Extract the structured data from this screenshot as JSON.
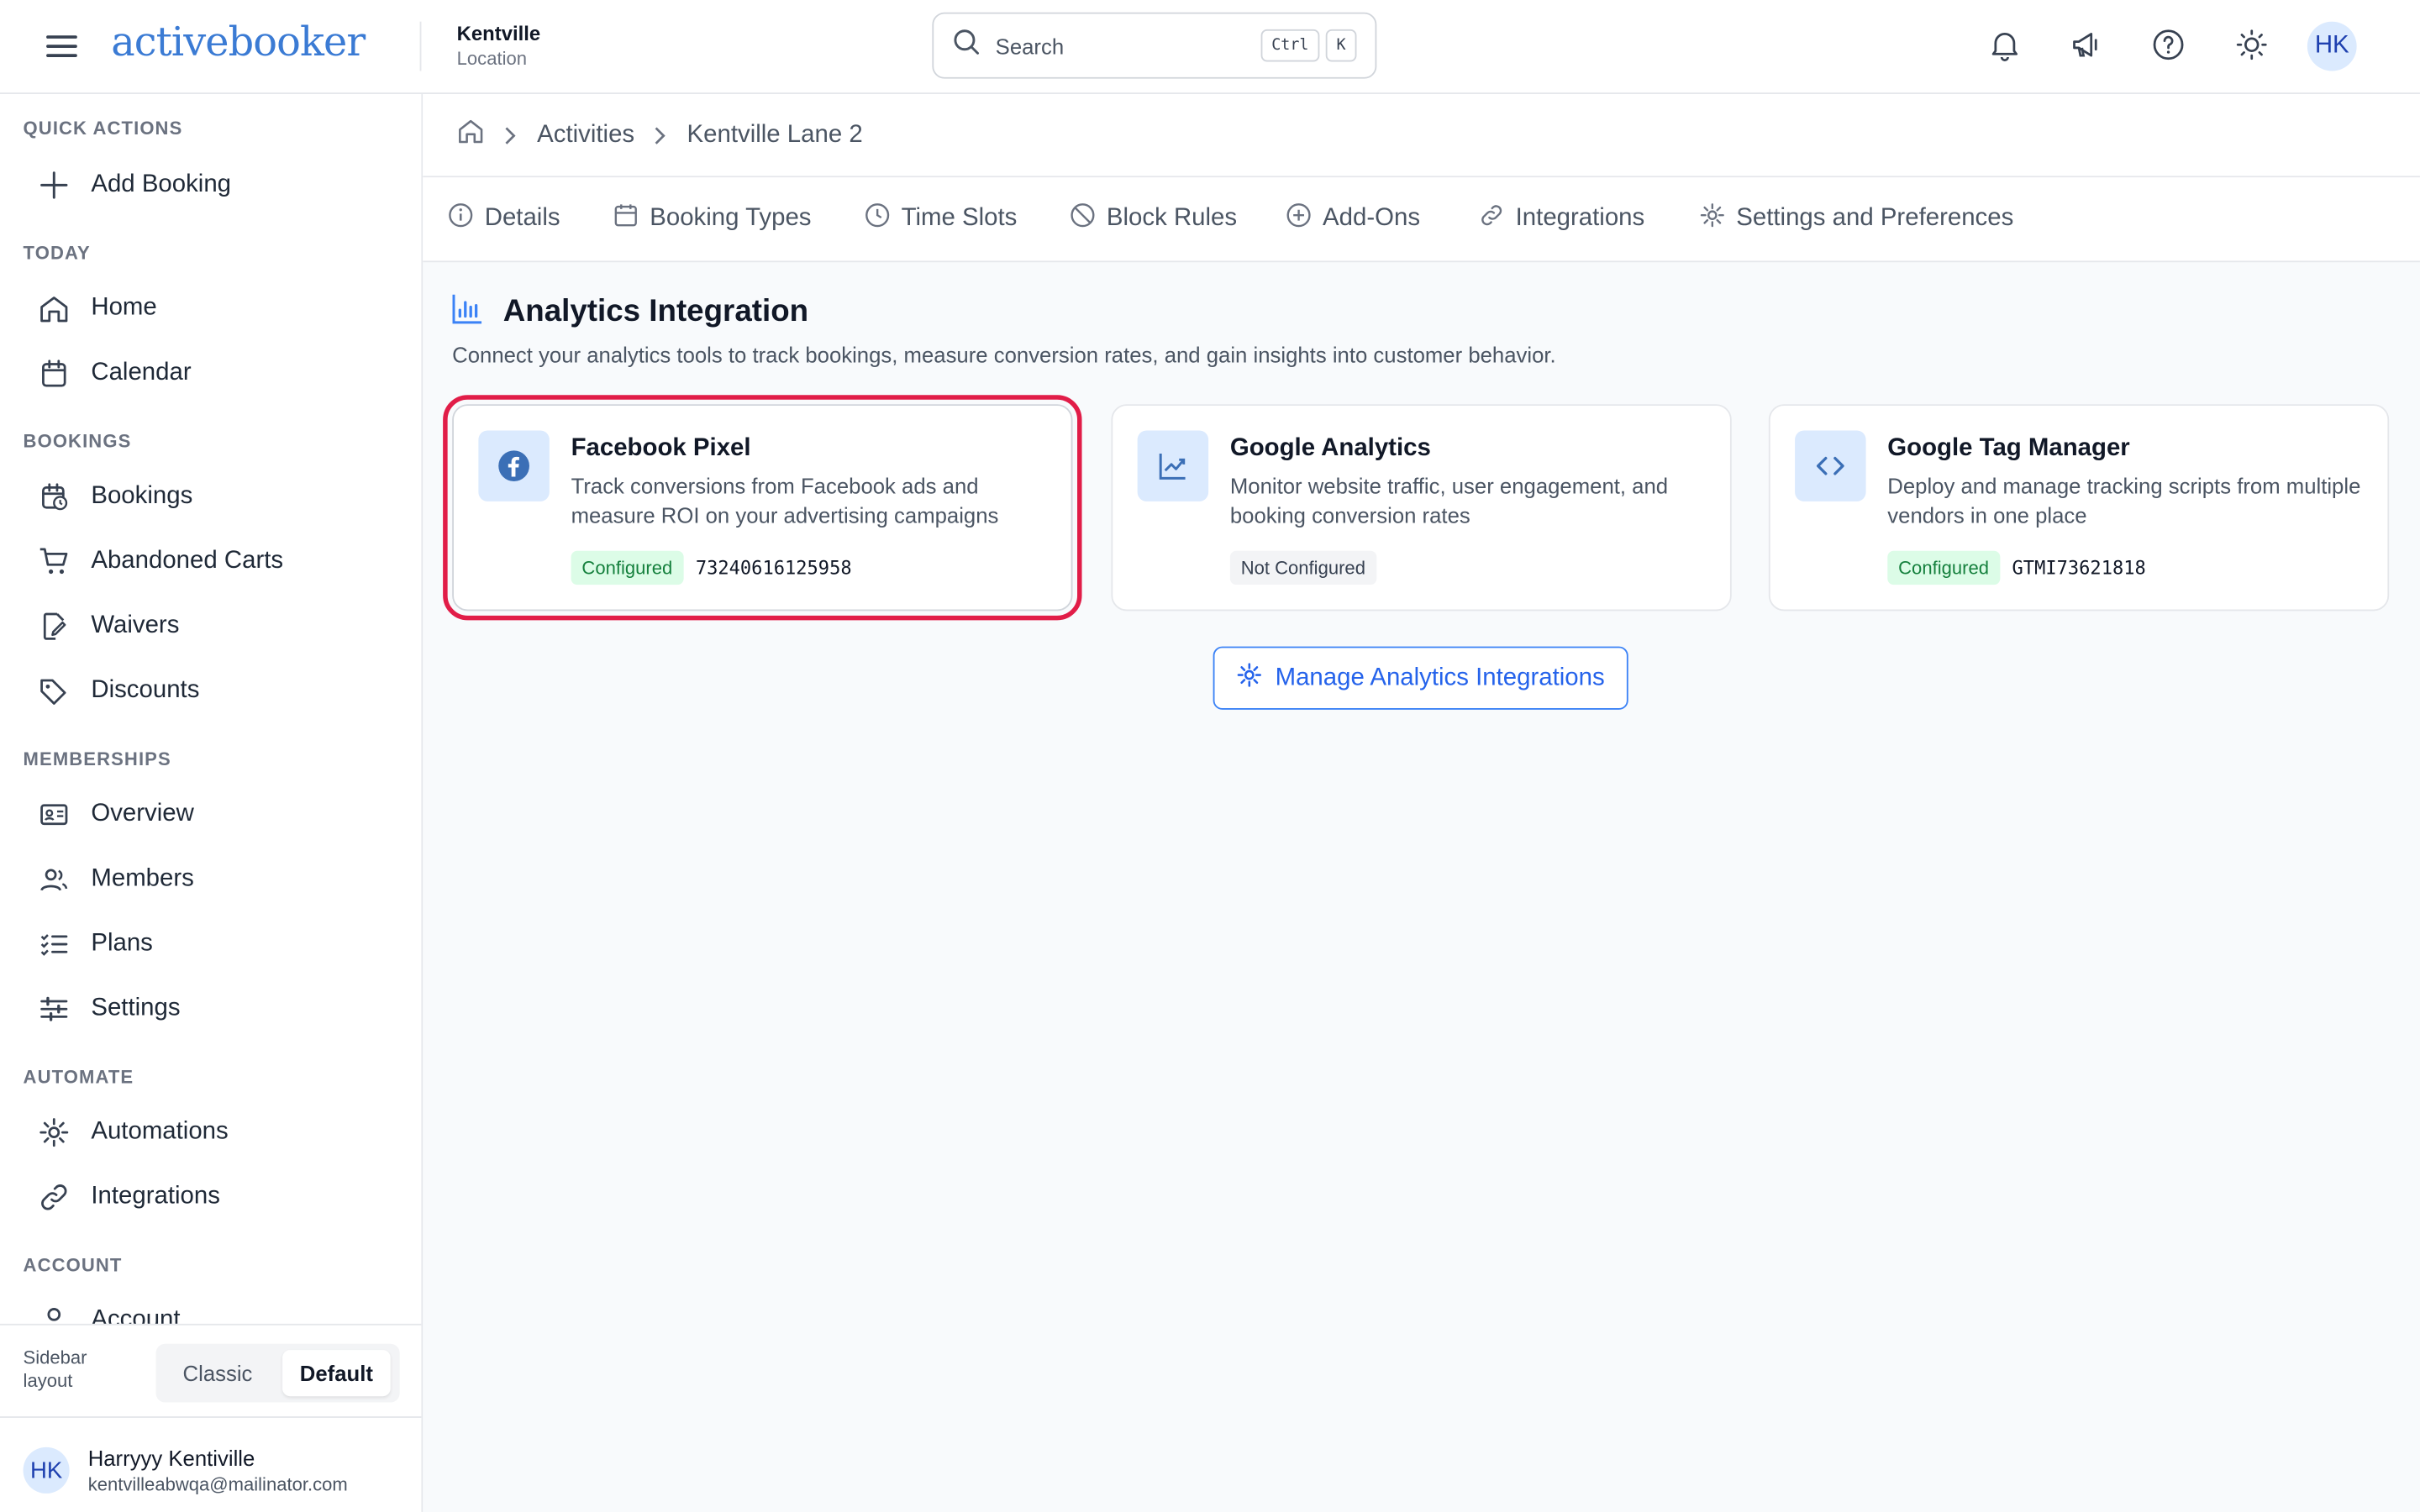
{
  "header": {
    "logo_text": "activebooker",
    "location_name": "Kentville",
    "location_sub": "Location",
    "search_placeholder": "Search",
    "shortcut_ctrl": "Ctrl",
    "shortcut_key": "K",
    "avatar_initials": "HK"
  },
  "sidebar": {
    "sections": {
      "quick_actions": "QUICK ACTIONS",
      "today": "TODAY",
      "bookings": "BOOKINGS",
      "memberships": "MEMBERSHIPS",
      "automate": "AUTOMATE",
      "account": "ACCOUNT"
    },
    "items": {
      "add_booking": "Add Booking",
      "home": "Home",
      "calendar": "Calendar",
      "bookings": "Bookings",
      "abandoned_carts": "Abandoned Carts",
      "waivers": "Waivers",
      "discounts": "Discounts",
      "overview": "Overview",
      "members": "Members",
      "plans": "Plans",
      "settings": "Settings",
      "automations": "Automations",
      "integrations": "Integrations",
      "account": "Account"
    },
    "layout_label": "Sidebar layout",
    "layout_options": [
      "Classic",
      "Default"
    ],
    "layout_selected": "Default",
    "user": {
      "initials": "HK",
      "name": "Harryyy Kentiville",
      "email": "kentvilleabwqa@mailinator.com"
    }
  },
  "breadcrumb": [
    "Activities",
    "Kentville Lane 2"
  ],
  "tabs": [
    "Details",
    "Booking Types",
    "Time Slots",
    "Block Rules",
    "Add-Ons",
    "Integrations",
    "Settings and Preferences"
  ],
  "section": {
    "title": "Analytics Integration",
    "description": "Connect your analytics tools to track bookings, measure conversion rates, and gain insights into customer behavior."
  },
  "cards": [
    {
      "icon": "facebook-icon",
      "title": "Facebook Pixel",
      "description": "Track conversions from Facebook ads and measure ROI on your advertising campaigns",
      "status": "Configured",
      "code": "73240616125958"
    },
    {
      "icon": "chart-line-icon",
      "title": "Google Analytics",
      "description": "Monitor website traffic, user engagement, and booking conversion rates",
      "status": "Not Configured",
      "code": ""
    },
    {
      "icon": "code-icon",
      "title": "Google Tag Manager",
      "description": "Deploy and manage tracking scripts from multiple vendors in one place",
      "status": "Configured",
      "code": "GTMI73621818"
    }
  ],
  "manage_button": "Manage Analytics Integrations",
  "colors": {
    "accent": "#2563eb",
    "brand": "#3b7bd4",
    "highlight": "#e11d48",
    "configured_bg": "#dcfce7",
    "configured_text": "#15803d"
  }
}
